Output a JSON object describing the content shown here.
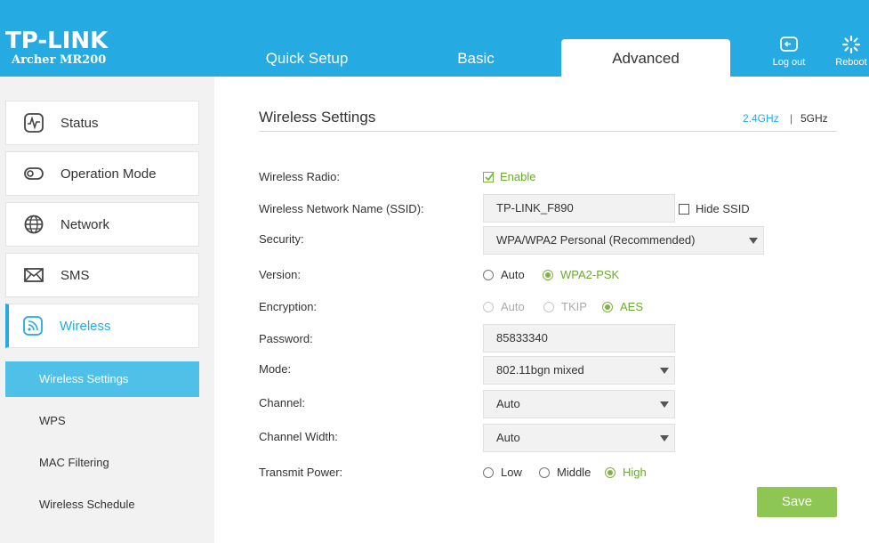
{
  "header": {
    "brand": "TP-LINK",
    "model": "Archer MR200",
    "tabs": [
      {
        "label": "Quick Setup"
      },
      {
        "label": "Basic"
      },
      {
        "label": "Advanced"
      }
    ],
    "logout_label": "Log out",
    "reboot_label": "Reboot"
  },
  "sidebar": {
    "items": [
      {
        "label": "Status",
        "icon": "status-icon"
      },
      {
        "label": "Operation Mode",
        "icon": "operation-mode-icon"
      },
      {
        "label": "Network",
        "icon": "globe-icon"
      },
      {
        "label": "SMS",
        "icon": "envelope-icon"
      },
      {
        "label": "Wireless",
        "icon": "wireless-icon"
      }
    ],
    "subitems": [
      {
        "label": "Wireless Settings"
      },
      {
        "label": "WPS"
      },
      {
        "label": "MAC Filtering"
      },
      {
        "label": "Wireless Schedule"
      }
    ]
  },
  "main": {
    "title": "Wireless Settings",
    "band_24": "2.4GHz",
    "band_sep": "|",
    "band_5": "5GHz",
    "labels": {
      "radio": "Wireless Radio:",
      "ssid": "Wireless Network Name (SSID):",
      "security": "Security:",
      "version": "Version:",
      "encryption": "Encryption:",
      "password": "Password:",
      "mode": "Mode:",
      "channel": "Channel:",
      "channel_width": "Channel Width:",
      "transmit_power": "Transmit Power:"
    },
    "enable_label": "Enable",
    "ssid_value": "TP-LINK_F890",
    "hide_ssid_label": "Hide SSID",
    "security_value": "WPA/WPA2 Personal (Recommended)",
    "version_options": [
      "Auto",
      "WPA2-PSK"
    ],
    "encryption_options": [
      "Auto",
      "TKIP",
      "AES"
    ],
    "password_value": "85833340",
    "mode_value": "802.11bgn mixed",
    "channel_value": "Auto",
    "channel_width_value": "Auto",
    "power_options": [
      "Low",
      "Middle",
      "High"
    ],
    "save_label": "Save"
  },
  "colors": {
    "header_blue": "#26aae2",
    "active_sub": "#4fc1e9",
    "accent_green": "#7cb342",
    "save_green": "#8dc653"
  }
}
